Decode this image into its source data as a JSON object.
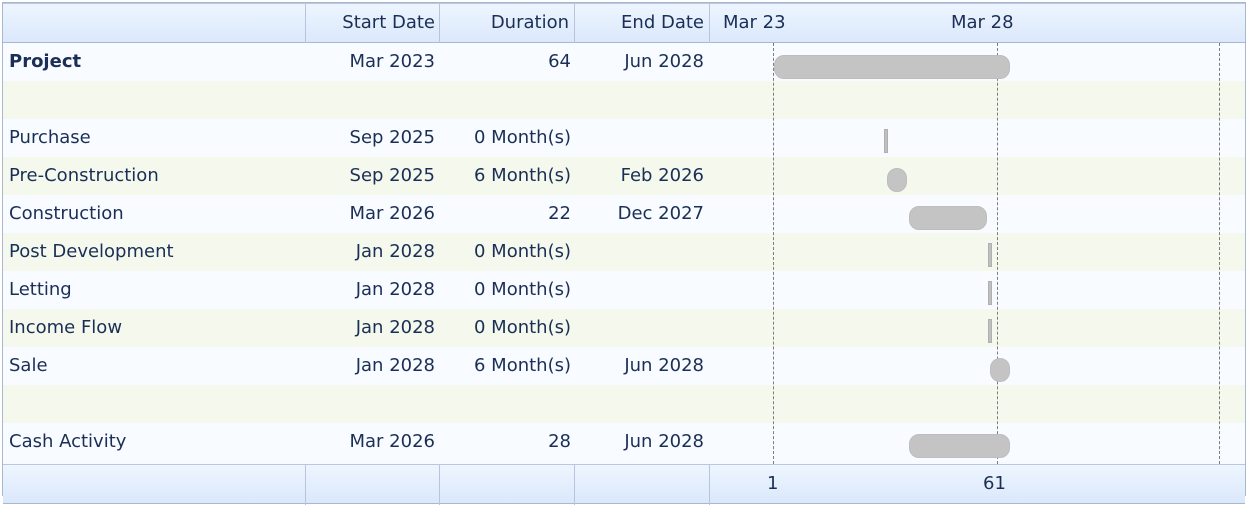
{
  "header": {
    "columns": {
      "start": "Start Date",
      "duration": "Duration",
      "end": "End Date"
    },
    "timeline": {
      "left": "Mar 23",
      "right": "Mar 28"
    }
  },
  "rows": [
    {
      "name": "Project",
      "start": "Mar 2023",
      "duration": "64",
      "end": "Jun 2028",
      "bold": true
    },
    {
      "name": "",
      "start": "",
      "duration": "",
      "end": ""
    },
    {
      "name": "Purchase",
      "start": "Sep 2025",
      "duration": "0 Month(s)",
      "end": ""
    },
    {
      "name": "Pre-Construction",
      "start": "Sep 2025",
      "duration": "6 Month(s)",
      "end": "Feb 2026"
    },
    {
      "name": "Construction",
      "start": "Mar 2026",
      "duration": "22",
      "end": "Dec 2027"
    },
    {
      "name": "Post Development",
      "start": "Jan 2028",
      "duration": "0 Month(s)",
      "end": ""
    },
    {
      "name": "Letting",
      "start": "Jan 2028",
      "duration": "0 Month(s)",
      "end": ""
    },
    {
      "name": "Income Flow",
      "start": "Jan 2028",
      "duration": "0 Month(s)",
      "end": ""
    },
    {
      "name": "Sale",
      "start": "Jan 2028",
      "duration": "6 Month(s)",
      "end": "Jun 2028"
    },
    {
      "name": "",
      "start": "",
      "duration": "",
      "end": ""
    },
    {
      "name": "Cash Activity",
      "start": "Mar 2026",
      "duration": "28",
      "end": "Jun 2028"
    }
  ],
  "footer": {
    "left": "1",
    "right": "61"
  },
  "colors": {
    "header_bg": "#dbe8fb",
    "text": "#1b2f56",
    "bar": "#c4c4c4",
    "alternate_row": "#f4f8ed"
  }
}
